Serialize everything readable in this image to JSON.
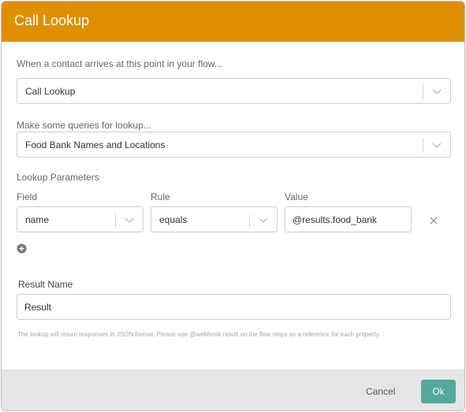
{
  "dialog": {
    "title": "Call Lookup"
  },
  "action": {
    "label": "When a contact arrives at this point in your flow...",
    "selected": "Call Lookup"
  },
  "query": {
    "label": "Make some queries for lookup...",
    "selected": "Food Bank Names and Locations"
  },
  "parameters": {
    "section_label": "Lookup Parameters",
    "field_header": "Field",
    "rule_header": "Rule",
    "value_header": "Value",
    "rows": [
      {
        "field": "name",
        "rule": "equals",
        "value": "@results.food_bank"
      }
    ]
  },
  "result": {
    "label": "Result Name",
    "value": "Result"
  },
  "hint": "The lookup will return responses in JSON format. Please use @webhook.result on the flow steps as a reference for each property.",
  "buttons": {
    "cancel": "Cancel",
    "ok": "Ok"
  },
  "icons": {
    "dropdown": "chevron-down-icon",
    "remove": "close-icon",
    "add": "plus-circle-icon"
  },
  "colors": {
    "header": "#df9002",
    "primary_button": "#55a89c",
    "footer": "#e6e6e6"
  }
}
